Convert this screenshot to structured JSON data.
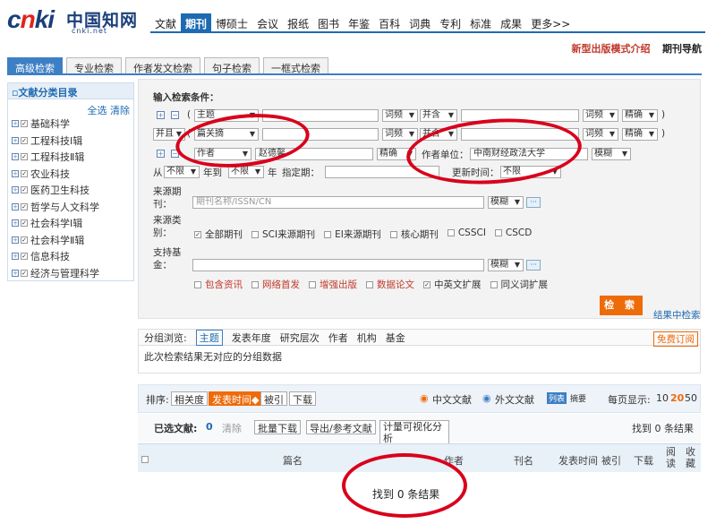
{
  "logo": {
    "brand": "cnki",
    "name": "中国知网",
    "domain": "cnki.net"
  },
  "nav": [
    "文献",
    "期刊",
    "博硕士",
    "会议",
    "报纸",
    "图书",
    "年鉴",
    "百科",
    "词典",
    "专利",
    "标准",
    "成果",
    "更多>>"
  ],
  "nav_active": "期刊",
  "toplinks": {
    "new": "新型出版模式介绍",
    "guide": "期刊导航"
  },
  "tabs": [
    "高级检索",
    "专业检索",
    "作者发文检索",
    "句子检索",
    "一框式检索"
  ],
  "left": {
    "title": "文献分类目录",
    "select_all": "全选",
    "clear": "清除",
    "items": [
      "基础科学",
      "工程科技Ⅰ辑",
      "工程科技Ⅱ辑",
      "农业科技",
      "医药卫生科技",
      "哲学与人文科学",
      "社会科学Ⅰ辑",
      "社会科学Ⅱ辑",
      "信息科技",
      "经济与管理科学"
    ]
  },
  "form": {
    "heading": "输入检索条件：",
    "row1": {
      "field": "主题",
      "freq": "词频",
      "op": "并含",
      "freq2": "词频",
      "match": "精确"
    },
    "row2": {
      "logic": "并且",
      "field": "篇关摘",
      "freq": "词频",
      "op": "并含",
      "freq2": "词频",
      "match": "精确"
    },
    "row3": {
      "field": "作者",
      "value": "赵德馨",
      "match": "精确",
      "unit_label": "作者单位：",
      "unit_value": "中南财经政法大学",
      "unit_match": "模糊"
    },
    "row4": {
      "from": "从",
      "from_val": "不限",
      "year1": "年到",
      "to_val": "不限",
      "year2": "年",
      "date_label": "指定期：",
      "update_label": "更新时间：",
      "update_val": "不限"
    },
    "source_label": "来源期刊：",
    "source_placeholder": "期刊名称/ISSN/CN",
    "source_match": "模糊",
    "cat_label": "来源类别：",
    "cats": [
      "全部期刊",
      "SCI来源期刊",
      "EI来源期刊",
      "核心期刊",
      "CSSCI",
      "CSCD"
    ],
    "fund_label": "支持基金：",
    "fund_match": "模糊",
    "ext": [
      "包含资讯",
      "网络首发",
      "增强出版",
      "数据论文",
      "中英文扩展",
      "同义词扩展"
    ],
    "search": "检 索",
    "rescope": "结果中检索"
  },
  "group": {
    "label": "分组浏览:",
    "tabs": [
      "主题",
      "发表年度",
      "研究层次",
      "作者",
      "机构",
      "基金"
    ],
    "free": "免费订阅",
    "msg": "此次检索结果无对应的分组数据"
  },
  "sort": {
    "label": "排序:",
    "items": [
      "相关度",
      "发表时间◆",
      "被引",
      "下载"
    ],
    "zh": "中文文献",
    "en": "外文文献",
    "list": "列表",
    "abs": "摘要",
    "perpage": "每页显示:",
    "sizes": [
      "10",
      "20",
      "50"
    ]
  },
  "selected": {
    "label": "已选文献:",
    "count": "0",
    "clear": "清除",
    "batch": "批量下载",
    "export": "导出/参考文献",
    "viz": "计量可视化分析",
    "found": "找到 0 条结果"
  },
  "table": {
    "cols": [
      "篇名",
      "作者",
      "刊名",
      "发表时间",
      "被引",
      "下载",
      "阅读",
      "收藏"
    ]
  },
  "empty": "找到 0 条结果",
  "colors": {
    "accent": "#1d6ab2",
    "ring": "#d9001b",
    "search": "#ee6b0a"
  }
}
